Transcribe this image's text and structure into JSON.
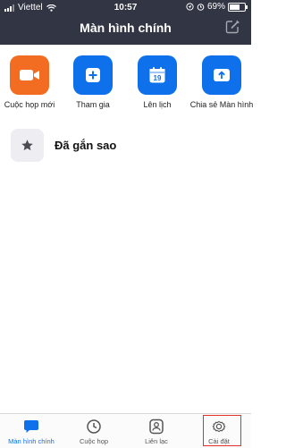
{
  "status_bar": {
    "carrier": "Viettel",
    "time": "10:57",
    "battery_percent": "69%",
    "battery_level": 0.69
  },
  "header": {
    "title": "Màn hình chính",
    "compose_icon": "compose-icon"
  },
  "actions": [
    {
      "label": "Cuộc họp mới",
      "icon": "video-camera-icon",
      "color": "#f26d21"
    },
    {
      "label": "Tham gia",
      "icon": "plus-icon",
      "color": "#0e71eb"
    },
    {
      "label": "Lên lịch",
      "icon": "calendar-icon",
      "icon_text": "19",
      "color": "#0e71eb"
    },
    {
      "label": "Chia sẻ Màn hình",
      "icon": "share-screen-icon",
      "color": "#0e71eb"
    }
  ],
  "starred": {
    "label": "Đã gắn sao",
    "icon": "star-icon"
  },
  "tabs": [
    {
      "label": "Màn hình chính",
      "icon": "chat-bubble-icon",
      "active": true
    },
    {
      "label": "Cuộc họp",
      "icon": "clock-icon",
      "active": false
    },
    {
      "label": "Liên lạc",
      "icon": "contact-icon",
      "active": false
    },
    {
      "label": "Cài đặt",
      "icon": "gear-icon",
      "active": false
    }
  ],
  "colors": {
    "header_bg": "#323543",
    "accent": "#0e71eb",
    "orange": "#f26d21",
    "highlight": "#e3312a"
  }
}
